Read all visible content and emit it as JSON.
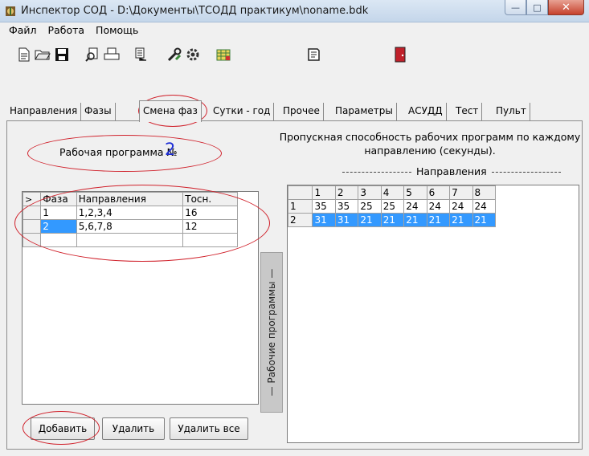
{
  "window": {
    "title": "Инспектор СОД - D:\\Документы\\ТСОДД практикум\\noname.bdk",
    "controls": {
      "minimize": "—",
      "maximize": "□",
      "close": "✕"
    }
  },
  "menu": [
    "Файл",
    "Работа",
    "Помощь"
  ],
  "toolbar": [
    "new-file-icon",
    "open-folder-icon",
    "save-disk-icon",
    "print-preview-icon",
    "print-icon",
    "report-icon",
    "tools-icon",
    "settings-gear-icon",
    "table-icon",
    "notebook-icon",
    "exit-door-icon"
  ],
  "tabs": [
    "Направления",
    "Фазы",
    "Смена фаз",
    "Сутки - год",
    "Прочее",
    "Параметры",
    "АСУДД",
    "Тест",
    "Пульт"
  ],
  "active_tab": "Смена фаз",
  "program": {
    "label": "Рабочая программа №",
    "number": "2"
  },
  "phase_table": {
    "columns": [
      "Фаза",
      "Направления",
      "Тосн."
    ],
    "rows": [
      {
        "phase": "1",
        "directions": "1,2,3,4",
        "t": "16",
        "selected": false
      },
      {
        "phase": "2",
        "directions": "5,6,7,8",
        "t": "12",
        "selected": true
      }
    ]
  },
  "buttons": {
    "add": "Добавить",
    "delete": "Удалить",
    "delete_all": "Удалить все"
  },
  "side_label": "—   Рабочие программы   —",
  "capacity": {
    "title": "Пропускная способность рабочих программ по каждому направлению (секунды).",
    "directions_label": "Направления",
    "columns": [
      "1",
      "2",
      "3",
      "4",
      "5",
      "6",
      "7",
      "8"
    ],
    "rows": [
      {
        "program": "1",
        "values": [
          "35",
          "35",
          "25",
          "25",
          "24",
          "24",
          "24",
          "24"
        ],
        "selected": false
      },
      {
        "program": "2",
        "values": [
          "31",
          "31",
          "21",
          "21",
          "21",
          "21",
          "21",
          "21"
        ],
        "selected": true
      }
    ]
  },
  "colors": {
    "accent": "#3399ff",
    "annotation": "#d0212b",
    "program_number": "#1f2fd6"
  }
}
